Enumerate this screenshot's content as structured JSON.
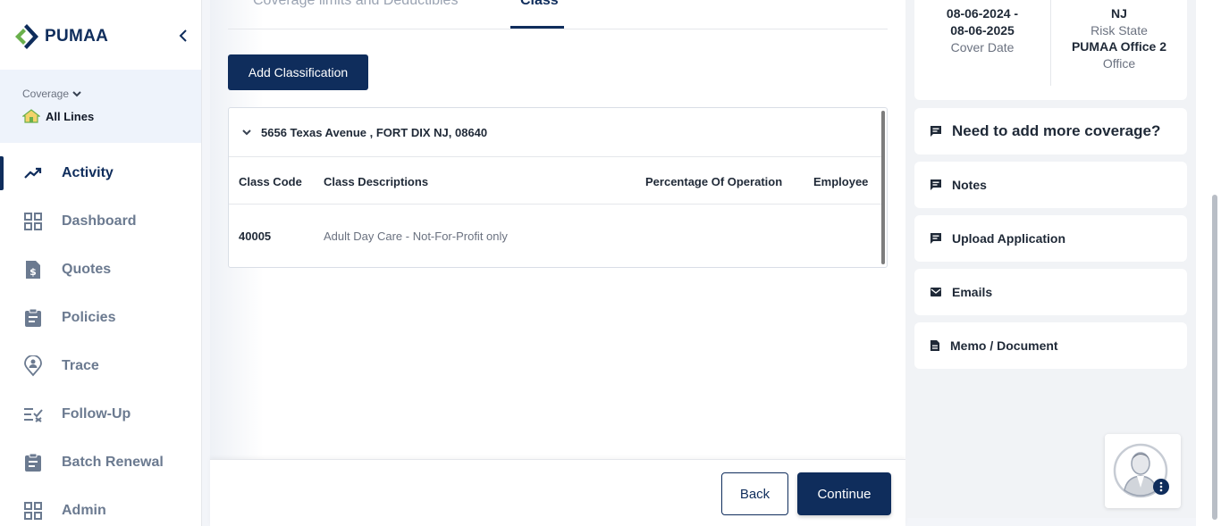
{
  "app": {
    "brand": "PUMAA"
  },
  "sidebar": {
    "coverage_label": "Coverage",
    "coverage_value": "All Lines",
    "items": [
      {
        "label": "Activity",
        "icon": "trending-up-icon",
        "active": true
      },
      {
        "label": "Dashboard",
        "icon": "grid-icon"
      },
      {
        "label": "Quotes",
        "icon": "dollar-file-icon"
      },
      {
        "label": "Policies",
        "icon": "clipboard-icon"
      },
      {
        "label": "Trace",
        "icon": "location-person-icon"
      },
      {
        "label": "Follow-Up",
        "icon": "list-check-icon"
      },
      {
        "label": "Batch Renewal",
        "icon": "clipboard-icon"
      },
      {
        "label": "Admin",
        "icon": "grid-icon"
      }
    ]
  },
  "main": {
    "tabs": [
      {
        "label": "Coverage limits and Deductibles"
      },
      {
        "label": "Class",
        "active": true
      }
    ],
    "add_classification_label": "Add Classification",
    "location": {
      "address": "5656 Texas Avenue , FORT DIX NJ, 08640",
      "columns": [
        "Class Code",
        "Class Descriptions",
        "Percentage Of Operation",
        "Employee"
      ],
      "rows": [
        {
          "code": "40005",
          "description": "Adult Day Care - Not-For-Profit only",
          "percentage": "",
          "employee": ""
        }
      ]
    },
    "back_label": "Back",
    "continue_label": "Continue"
  },
  "right_panel": {
    "cover_date_line1": "08-06-2024 -",
    "cover_date_line2": "08-06-2025",
    "cover_date_label": "Cover Date",
    "risk_state": "NJ",
    "risk_state_label": "Risk State",
    "office": "PUMAA Office 2",
    "office_label": "Office",
    "cards": [
      {
        "label": "Need to add more coverage?",
        "icon": "message-icon"
      },
      {
        "label": "Notes",
        "icon": "message-icon"
      },
      {
        "label": "Upload Application",
        "icon": "message-icon"
      },
      {
        "label": "Emails",
        "icon": "mail-icon"
      },
      {
        "label": "Memo / Document",
        "icon": "document-icon"
      }
    ]
  },
  "colors": {
    "primary": "#0f2d5c",
    "accent_green": "#6ab04c",
    "muted_text": "#6b7a90"
  }
}
